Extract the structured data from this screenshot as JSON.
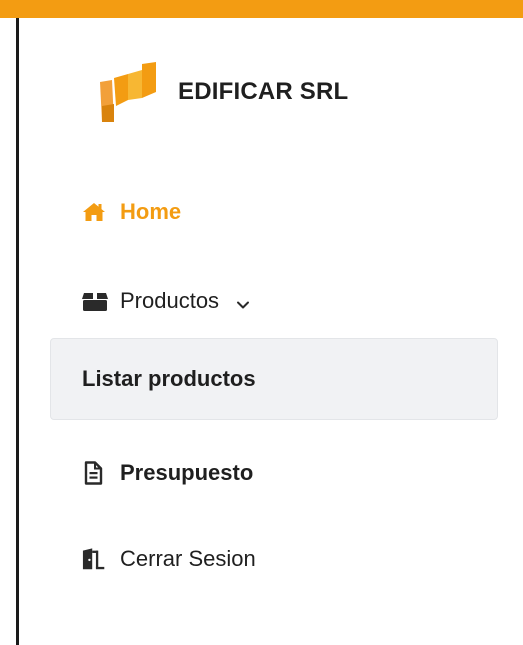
{
  "colors": {
    "accent": "#f39c12",
    "text": "#1f1f1f",
    "active_sub_bg": "#f1f2f4"
  },
  "brand": {
    "name": "EDIFICAR SRL",
    "logo_icon": "building-flags-logo"
  },
  "nav": {
    "home": {
      "label": "Home",
      "icon": "home-icon",
      "active": true
    },
    "products": {
      "label": "Productos",
      "icon": "box-icon",
      "expanded": true,
      "submenu": [
        {
          "label": "Listar productos",
          "selected": true
        }
      ]
    },
    "budget": {
      "label": "Presupuesto",
      "icon": "document-icon"
    },
    "logout": {
      "label": "Cerrar Sesion",
      "icon": "door-exit-icon"
    }
  }
}
